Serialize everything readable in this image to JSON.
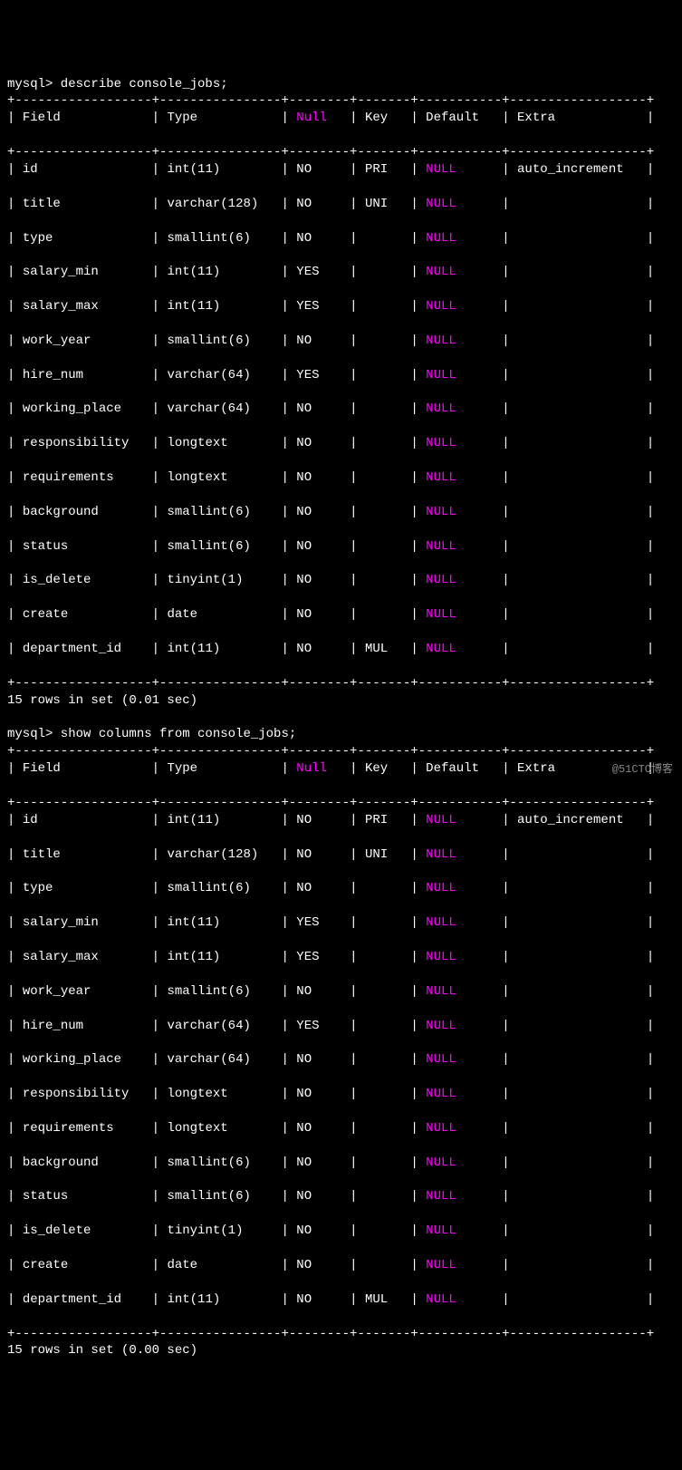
{
  "prompt1": "mysql> describe console_jobs;",
  "prompt2": "mysql> show columns from console_jobs;",
  "headers": {
    "field": "Field",
    "type": "Type",
    "null": "Null",
    "key": "Key",
    "default": "Default",
    "extra": "Extra"
  },
  "rows": [
    {
      "field": "id",
      "type": "int(11)",
      "null": "NO",
      "key": "PRI",
      "default": "NULL",
      "extra": "auto_increment"
    },
    {
      "field": "title",
      "type": "varchar(128)",
      "null": "NO",
      "key": "UNI",
      "default": "NULL",
      "extra": ""
    },
    {
      "field": "type",
      "type": "smallint(6)",
      "null": "NO",
      "key": "",
      "default": "NULL",
      "extra": ""
    },
    {
      "field": "salary_min",
      "type": "int(11)",
      "null": "YES",
      "key": "",
      "default": "NULL",
      "extra": ""
    },
    {
      "field": "salary_max",
      "type": "int(11)",
      "null": "YES",
      "key": "",
      "default": "NULL",
      "extra": ""
    },
    {
      "field": "work_year",
      "type": "smallint(6)",
      "null": "NO",
      "key": "",
      "default": "NULL",
      "extra": ""
    },
    {
      "field": "hire_num",
      "type": "varchar(64)",
      "null": "YES",
      "key": "",
      "default": "NULL",
      "extra": ""
    },
    {
      "field": "working_place",
      "type": "varchar(64)",
      "null": "NO",
      "key": "",
      "default": "NULL",
      "extra": ""
    },
    {
      "field": "responsibility",
      "type": "longtext",
      "null": "NO",
      "key": "",
      "default": "NULL",
      "extra": ""
    },
    {
      "field": "requirements",
      "type": "longtext",
      "null": "NO",
      "key": "",
      "default": "NULL",
      "extra": ""
    },
    {
      "field": "background",
      "type": "smallint(6)",
      "null": "NO",
      "key": "",
      "default": "NULL",
      "extra": ""
    },
    {
      "field": "status",
      "type": "smallint(6)",
      "null": "NO",
      "key": "",
      "default": "NULL",
      "extra": ""
    },
    {
      "field": "is_delete",
      "type": "tinyint(1)",
      "null": "NO",
      "key": "",
      "default": "NULL",
      "extra": ""
    },
    {
      "field": "create",
      "type": "date",
      "null": "NO",
      "key": "",
      "default": "NULL",
      "extra": ""
    },
    {
      "field": "department_id",
      "type": "int(11)",
      "null": "NO",
      "key": "MUL",
      "default": "NULL",
      "extra": ""
    }
  ],
  "result1": "15 rows in set (0.01 sec)",
  "result2": "15 rows in set (0.00 sec)",
  "watermark": "@51CTO博客",
  "widths": {
    "field": 16,
    "type": 14,
    "null": 6,
    "key": 5,
    "default": 9,
    "extra": 16
  }
}
